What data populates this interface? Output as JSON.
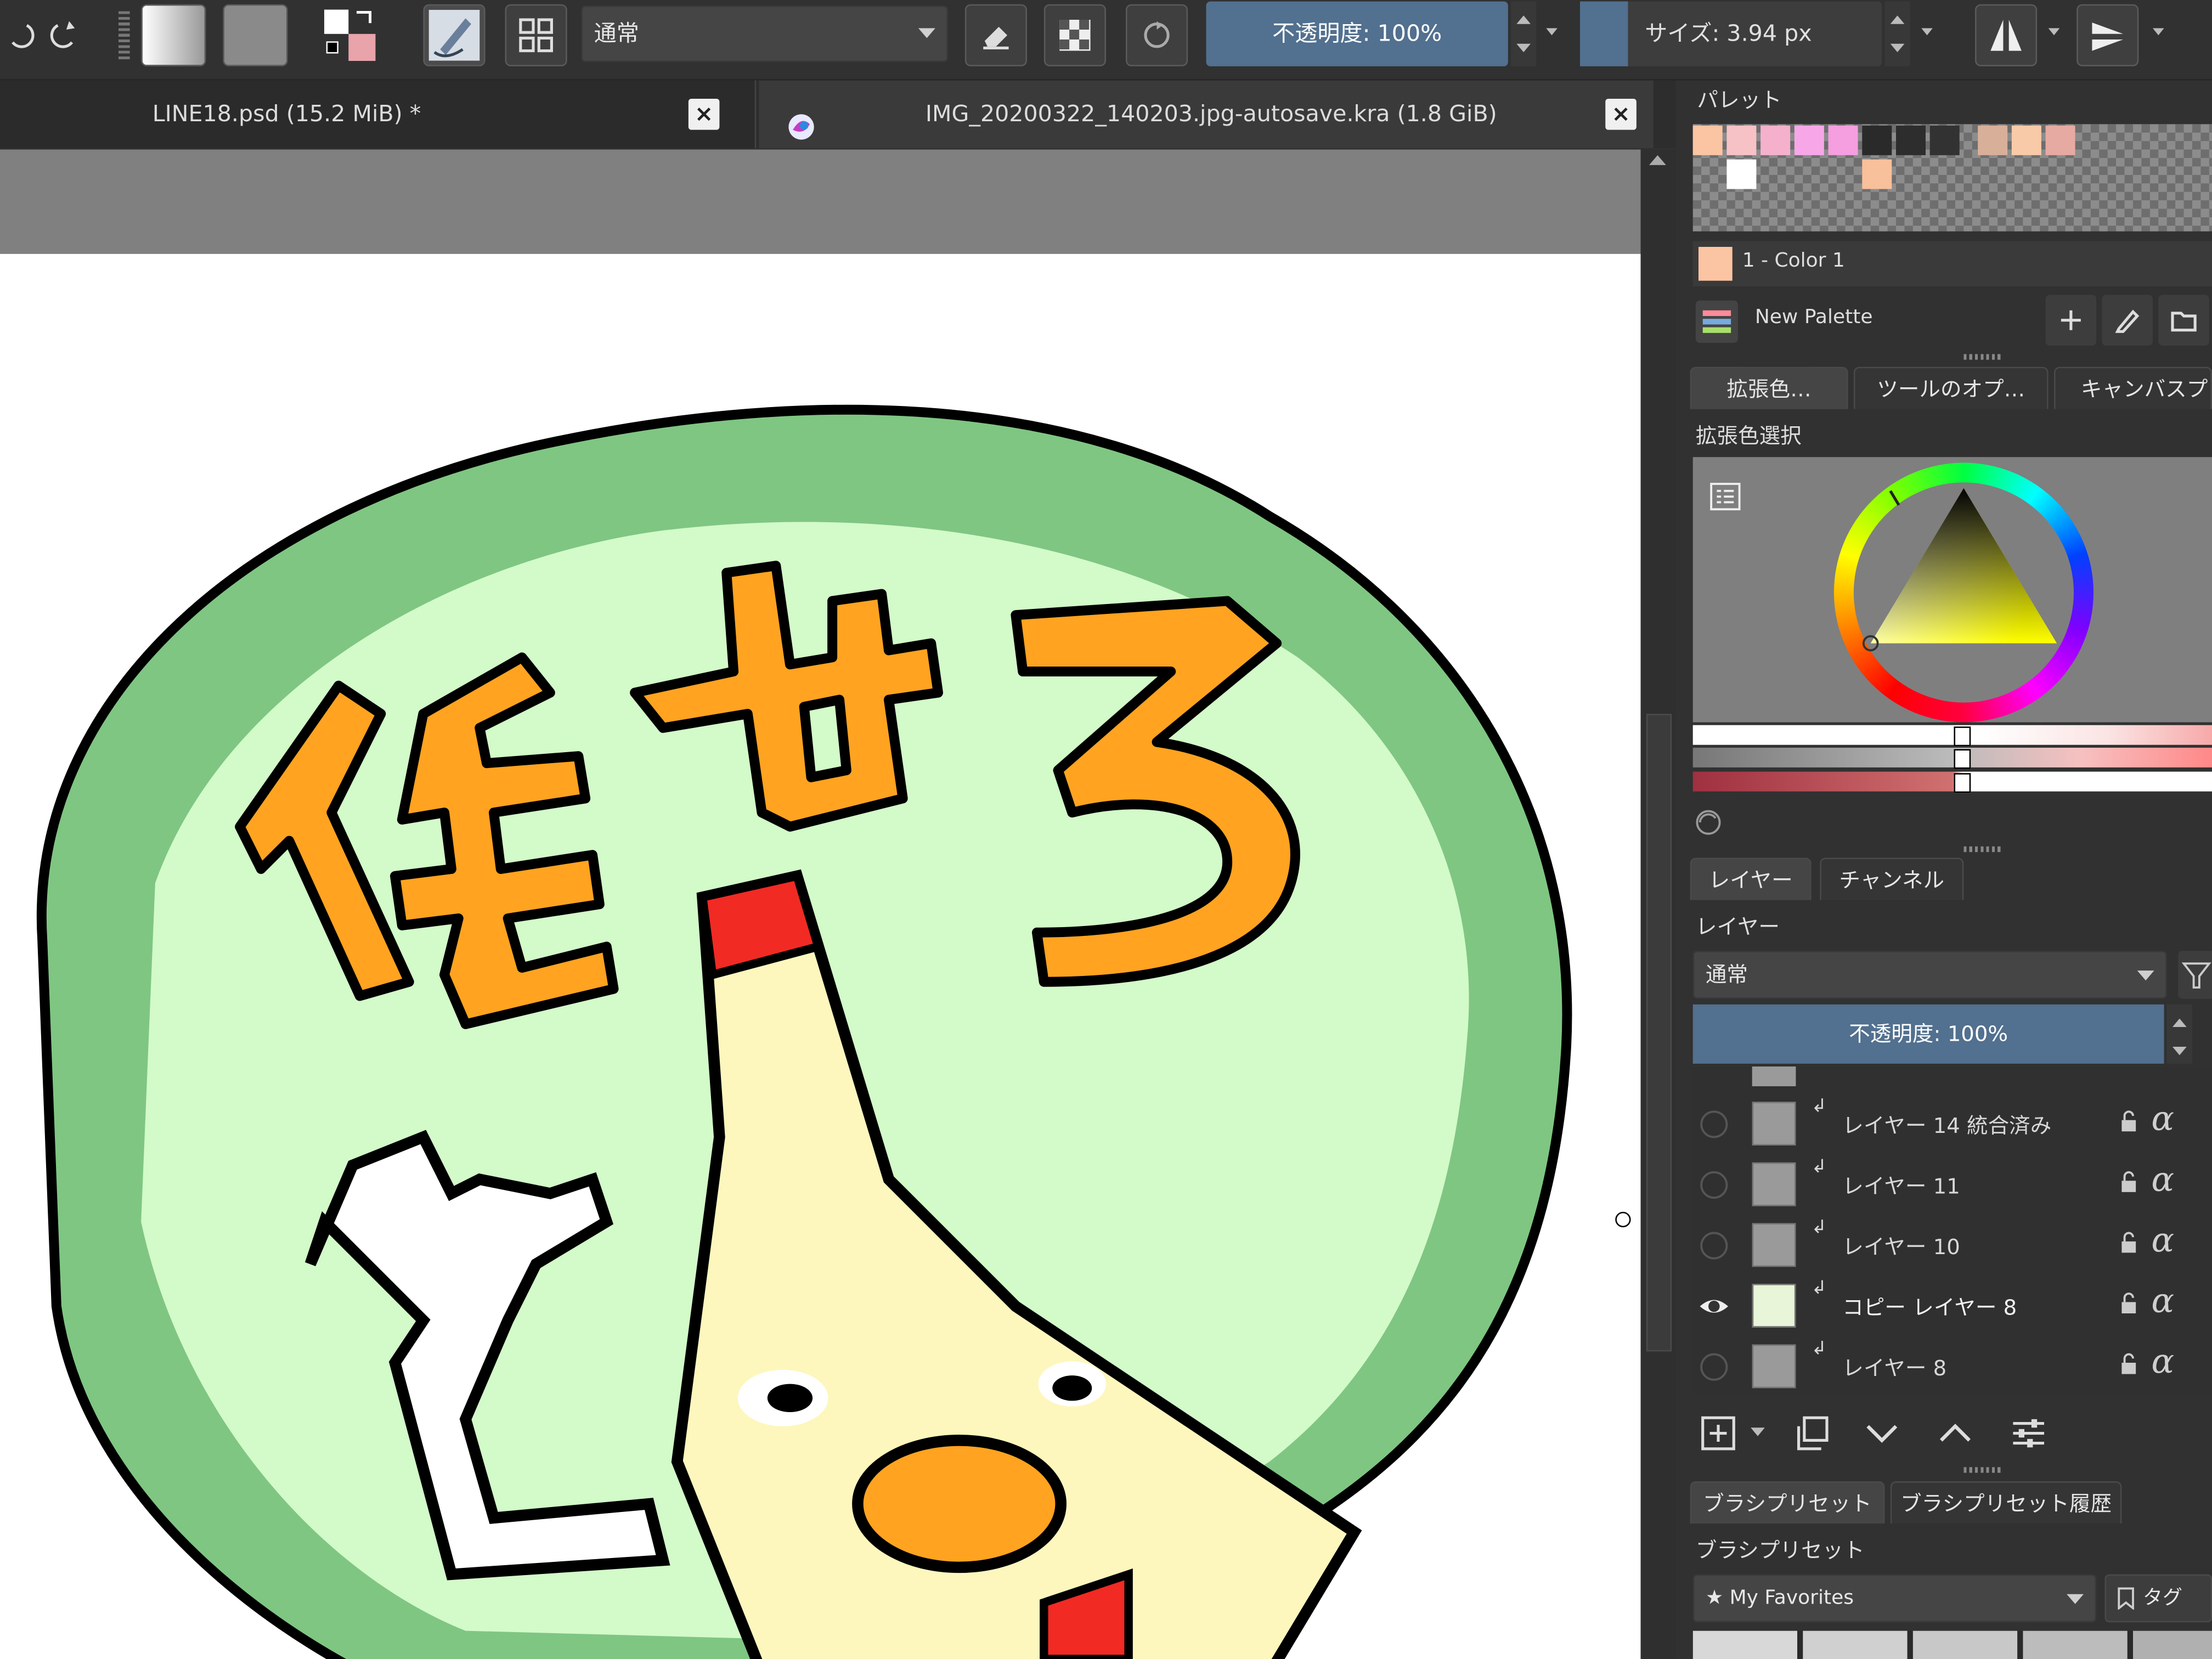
{
  "toolbar": {
    "blend_mode": "通常",
    "opacity_label": "不透明度: 100%",
    "size_label": "サイズ: 3.94 px"
  },
  "tabs": [
    {
      "label": "LINE18.psd (15.2 MiB) *"
    },
    {
      "label": "IMG_20200322_140203.jpg-autosave.kra (1.8 GiB)"
    }
  ],
  "palette": {
    "title": "パレット",
    "selected_color_name": "1 - Color 1",
    "palette_name": "New Palette",
    "swatch_colors": [
      "#fbc4a3",
      "#f7c2c6",
      "#f5b1cc",
      "#f7a7e8",
      "#f59ee0",
      "#2a2a2a",
      "#2d2d2d",
      "#323232",
      "#d8b09a",
      "#f8caa8",
      "#e7aaa2",
      "#ffffff",
      "#f8c09b"
    ]
  },
  "docker_tabs": [
    {
      "label": "拡張色…",
      "active": true
    },
    {
      "label": "ツールのオプ…",
      "active": false
    },
    {
      "label": "キャンバスプレ…",
      "active": false
    }
  ],
  "color_selector": {
    "title": "拡張色選択"
  },
  "layers_tabs": [
    {
      "label": "レイヤー",
      "active": true
    },
    {
      "label": "チャンネル",
      "active": false
    }
  ],
  "layers": {
    "title": "レイヤー",
    "blend_mode": "通常",
    "opacity_label": "不透明度: 100%",
    "items": [
      {
        "name": "レイヤー 14 統合済み",
        "visible": false
      },
      {
        "name": "レイヤー 11",
        "visible": false
      },
      {
        "name": "レイヤー 10",
        "visible": false
      },
      {
        "name": "コピー レイヤー 8",
        "visible": true
      },
      {
        "name": "レイヤー 8",
        "visible": false
      }
    ]
  },
  "brush_tabs": [
    {
      "label": "ブラシプリセット",
      "active": true
    },
    {
      "label": "ブラシプリセット履歴",
      "active": false
    }
  ],
  "brush_presets": {
    "title": "ブラシプリセット",
    "filter_value": "★ My Favorites",
    "tag_label": "タグ"
  },
  "artwork": {
    "text": "任せろ",
    "colors": {
      "outline": "#000000",
      "outer_green": "#7fc682",
      "inner_green": "#d3fac9",
      "text_orange": "#ffa320",
      "red": "#f12a24",
      "cream": "#fdf7be"
    }
  }
}
